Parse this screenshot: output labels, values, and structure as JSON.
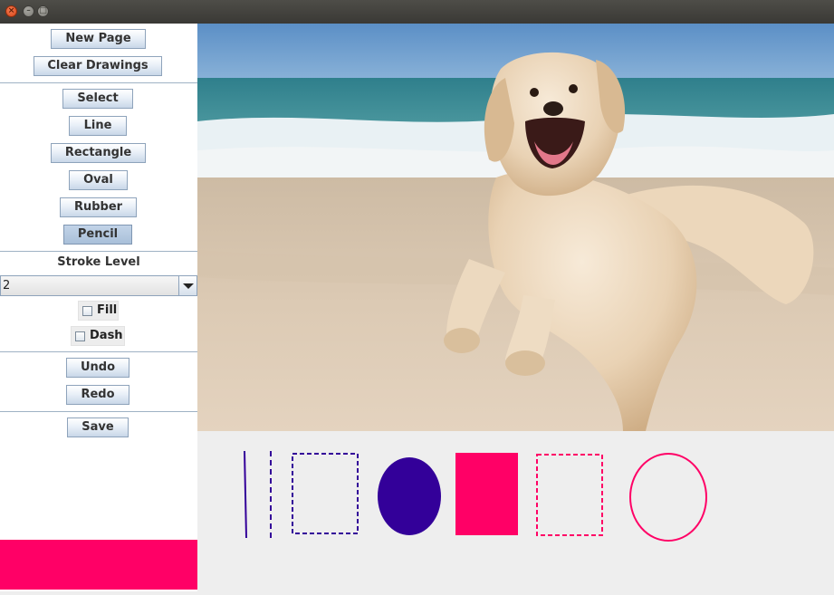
{
  "window": {
    "close_glyph": "×",
    "min_glyph": "–",
    "max_glyph": "□"
  },
  "sidebar": {
    "new_page": "New Page",
    "clear_drawings": "Clear Drawings",
    "tools": {
      "select": "Select",
      "line": "Line",
      "rectangle": "Rectangle",
      "oval": "Oval",
      "rubber": "Rubber",
      "pencil": "Pencil",
      "active": "Pencil"
    },
    "stroke_label": "Stroke Level",
    "stroke_value": "2",
    "fill_label": "Fill",
    "fill_checked": false,
    "dash_label": "Dash",
    "dash_checked": false,
    "undo": "Undo",
    "redo": "Redo",
    "save": "Save",
    "current_color": "#ff0066"
  },
  "colors": {
    "accent_pink": "#ff0066",
    "accent_purple": "#330099"
  },
  "canvas": {
    "image": "golden-retriever-running-on-beach",
    "shapes": [
      "line",
      "dashed-line",
      "dashed-rectangle",
      "filled-oval",
      "filled-rectangle",
      "dashed-rectangle",
      "oval"
    ]
  }
}
